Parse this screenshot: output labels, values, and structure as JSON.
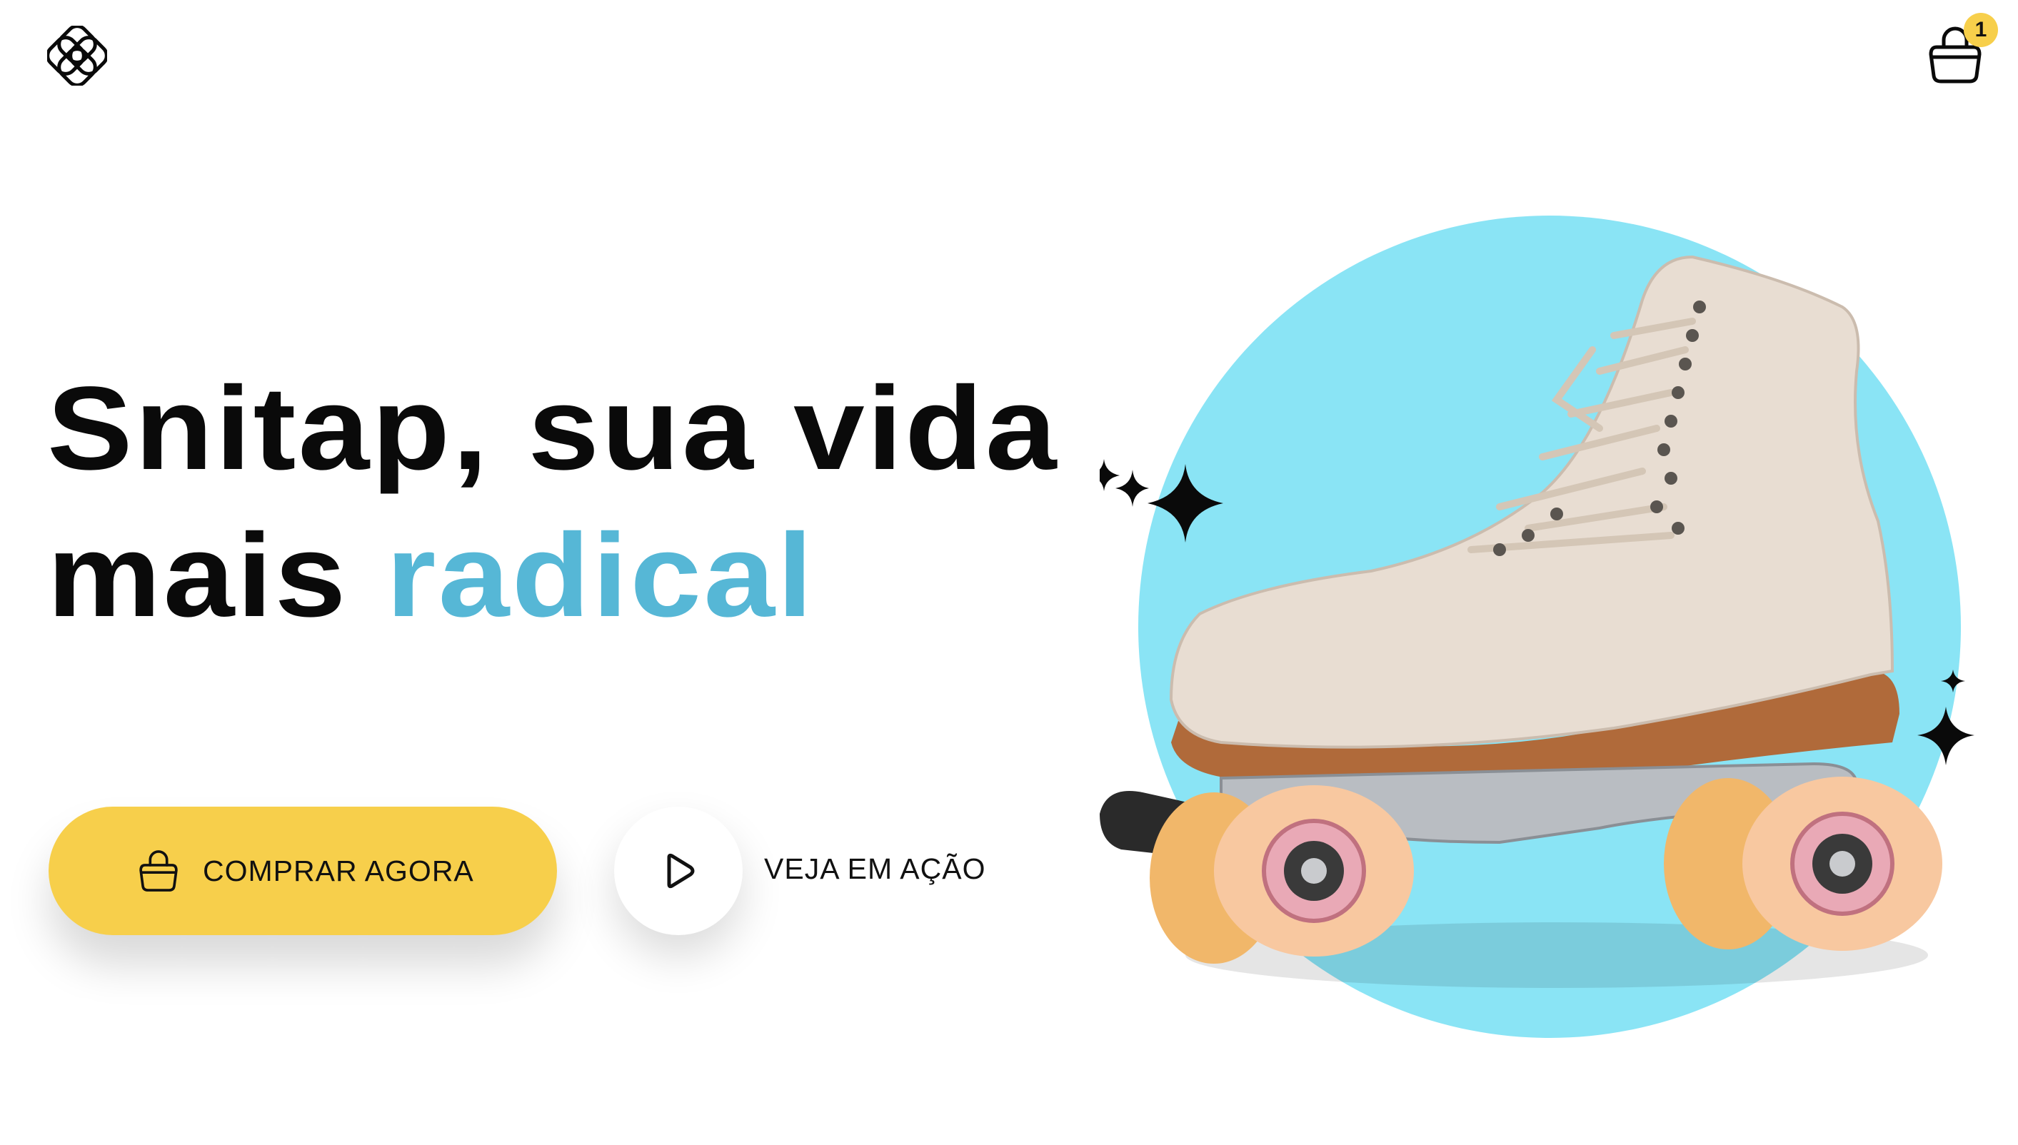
{
  "brand": {
    "logo_icon": "snitap-logo-icon"
  },
  "header": {
    "cart": {
      "icon": "shopping-bag-icon",
      "count": "1"
    }
  },
  "hero": {
    "headline_line1": "Snitap, sua vida",
    "headline_line2_prefix": "mais ",
    "headline_accent": "radical",
    "primary_button_label": "COMPRAR AGORA",
    "primary_button_icon": "shopping-bag-icon",
    "secondary_icon": "play-icon",
    "secondary_label": "VEJA EM AÇÃO",
    "image_icon": "roller-skate-illustration"
  },
  "colors": {
    "accent_yellow": "#f7cf4b",
    "accent_blue_text": "#56b7d6",
    "circle_blue": "#8ae4f5",
    "text": "#0a0a0a",
    "background": "#ffffff"
  }
}
